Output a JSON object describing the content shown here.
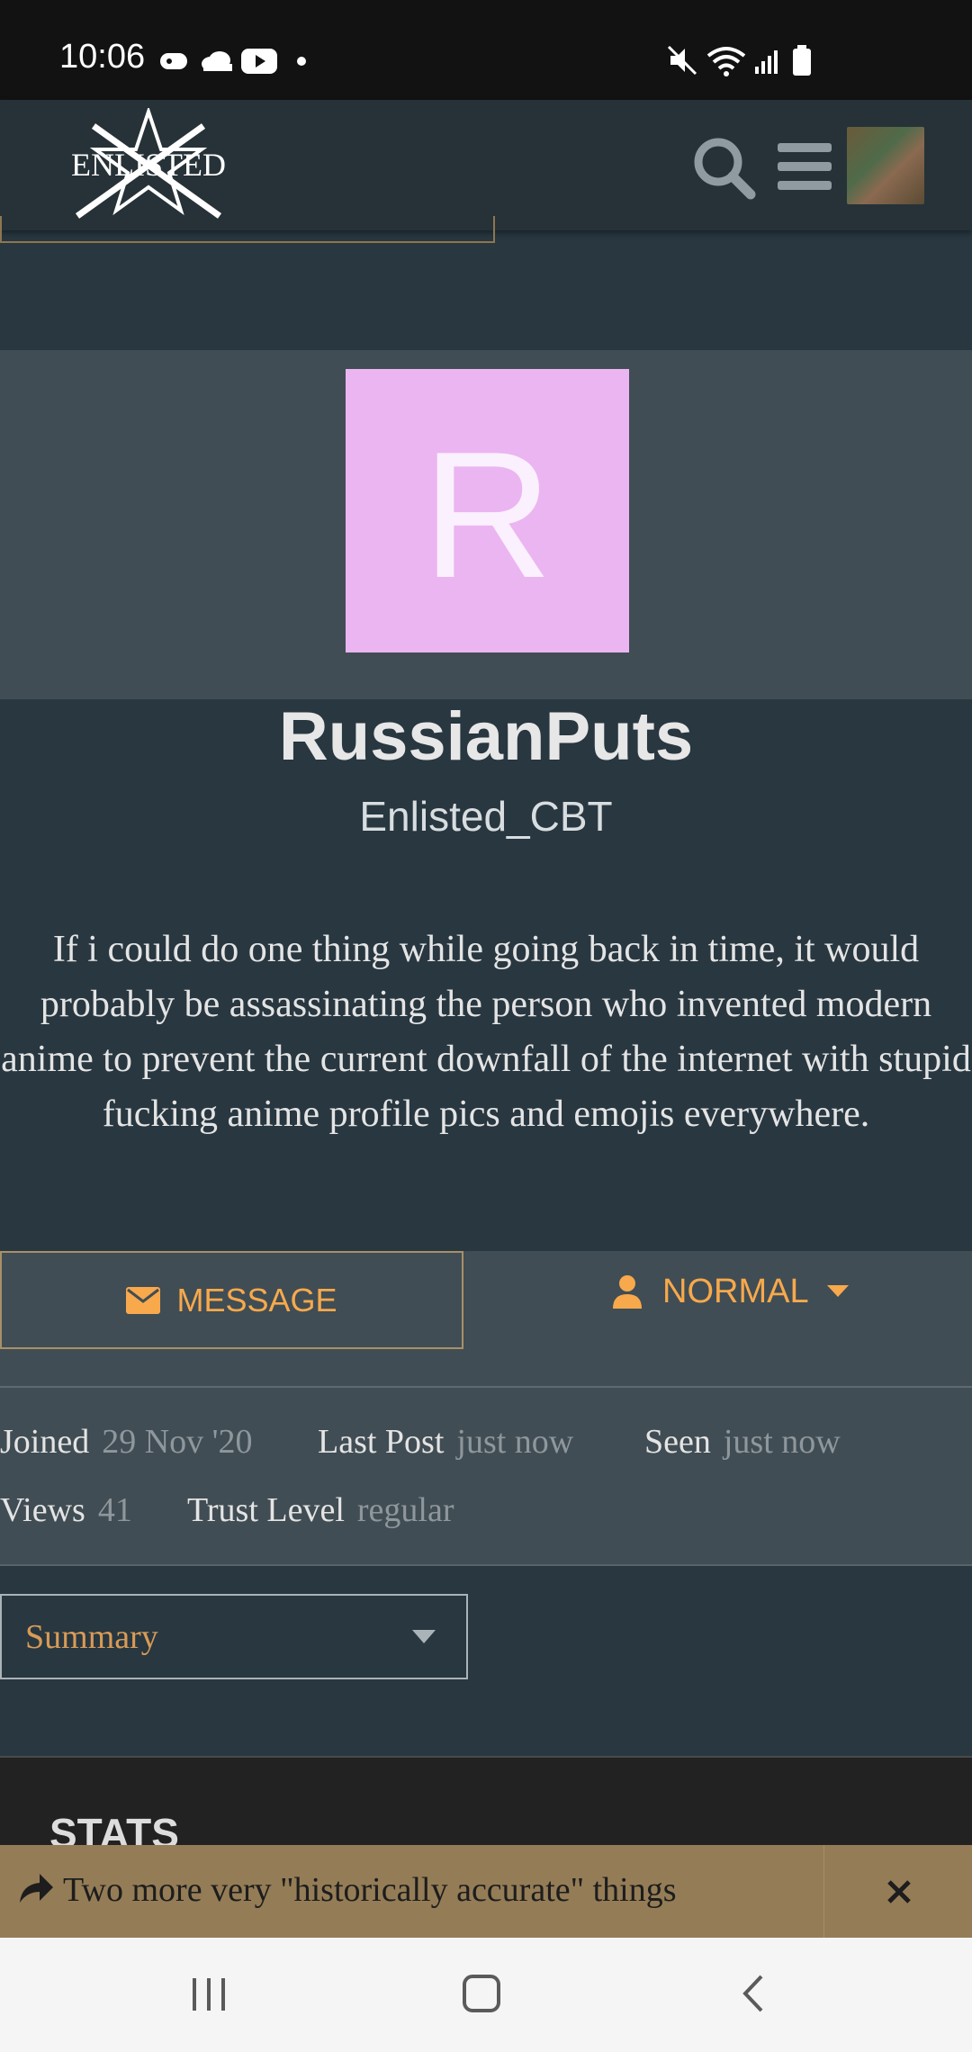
{
  "status_bar": {
    "time": "10:06"
  },
  "header": {
    "logo_text": "ENLISTED"
  },
  "profile": {
    "avatar_letter": "R",
    "username": "RussianPuts",
    "title": "Enlisted_CBT",
    "bio": "If i could do one thing while going back in time, it would probably be assassinating the person who invented modern anime to prevent the current downfall of the internet with stupid fucking anime profile pics and emojis everywhere."
  },
  "actions": {
    "message_label": "MESSAGE",
    "notification_level": "NORMAL"
  },
  "stats_meta": {
    "joined_label": "Joined",
    "joined_value": "29 Nov '20",
    "last_post_label": "Last Post",
    "last_post_value": "just now",
    "seen_label": "Seen",
    "seen_value": "just now",
    "views_label": "Views",
    "views_value": "41",
    "trust_label": "Trust Level",
    "trust_value": "regular"
  },
  "nav_select": {
    "selected": "Summary"
  },
  "stats_section": {
    "heading": "STATS"
  },
  "topic_banner": {
    "title": "Two more very \"historically accurate\" things"
  },
  "colors": {
    "accent": "#f7a94c",
    "avatar_bg": "#ebb5f1",
    "page_bg": "#283740",
    "banner_bg": "#947c56"
  }
}
